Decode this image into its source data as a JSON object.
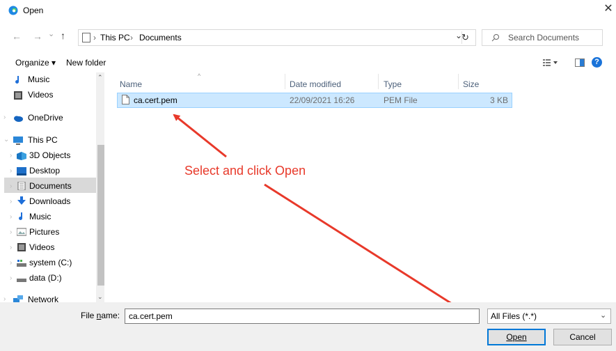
{
  "window": {
    "title": "Open",
    "close_glyph": "✕"
  },
  "nav": {
    "back_glyph": "←",
    "forward_glyph": "→",
    "recent_glyph": "⌄",
    "up_glyph": "↑",
    "breadcrumb": [
      "This PC",
      "Documents"
    ],
    "separator": "›",
    "dropdown_glyph": "⌄",
    "refresh_glyph": "↻",
    "search_placeholder": "Search Documents"
  },
  "toolbar": {
    "organize_label": "Organize ▾",
    "new_folder_label": "New folder",
    "help_glyph": "?"
  },
  "sidebar": {
    "items": [
      {
        "label": "Music",
        "icon": "music-icon"
      },
      {
        "label": "Videos",
        "icon": "videos-icon"
      },
      {
        "label": "OneDrive",
        "icon": "onedrive-icon"
      },
      {
        "label": "This PC",
        "icon": "pc-icon"
      },
      {
        "label": "3D Objects",
        "icon": "3d-objects-icon"
      },
      {
        "label": "Desktop",
        "icon": "desktop-icon"
      },
      {
        "label": "Documents",
        "icon": "documents-icon",
        "selected": true
      },
      {
        "label": "Downloads",
        "icon": "downloads-icon"
      },
      {
        "label": "Music",
        "icon": "music-icon"
      },
      {
        "label": "Pictures",
        "icon": "pictures-icon"
      },
      {
        "label": "Videos",
        "icon": "videos-icon"
      },
      {
        "label": "system (C:)",
        "icon": "drive-icon"
      },
      {
        "label": "data (D:)",
        "icon": "drive-icon"
      },
      {
        "label": "Network",
        "icon": "network-icon"
      }
    ]
  },
  "files": {
    "columns": [
      "Name",
      "Date modified",
      "Type",
      "Size"
    ],
    "rows": [
      {
        "name": "ca.cert.pem",
        "date": "22/09/2021 16:26",
        "type": "PEM File",
        "size": "3 KB"
      }
    ]
  },
  "annotation": {
    "text": "Select and click Open",
    "color": "#e8392a"
  },
  "footer": {
    "file_name_label_pre": "File ",
    "file_name_label_u": "n",
    "file_name_label_post": "ame:",
    "file_name_value": "ca.cert.pem",
    "filter_value": "All Files (*.*)",
    "open_label": "Open",
    "cancel_label": "Cancel"
  },
  "colors": {
    "selection": "#cce8ff",
    "accent": "#0078d7"
  }
}
